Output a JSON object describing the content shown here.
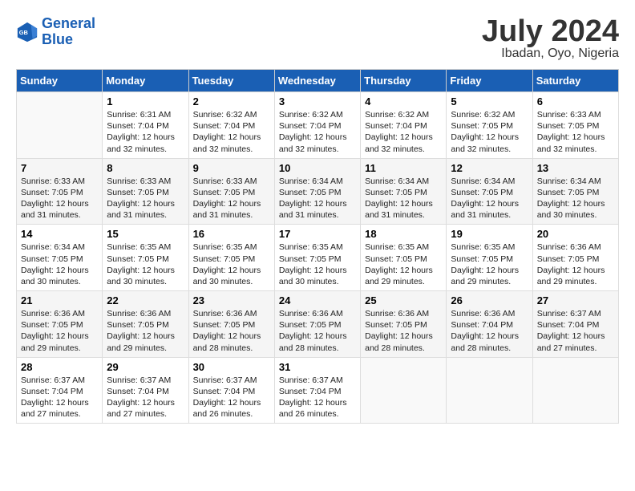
{
  "header": {
    "logo_line1": "General",
    "logo_line2": "Blue",
    "month": "July 2024",
    "location": "Ibadan, Oyo, Nigeria"
  },
  "weekdays": [
    "Sunday",
    "Monday",
    "Tuesday",
    "Wednesday",
    "Thursday",
    "Friday",
    "Saturday"
  ],
  "weeks": [
    [
      {
        "day": "",
        "content": ""
      },
      {
        "day": "1",
        "content": "Sunrise: 6:31 AM\nSunset: 7:04 PM\nDaylight: 12 hours\nand 32 minutes."
      },
      {
        "day": "2",
        "content": "Sunrise: 6:32 AM\nSunset: 7:04 PM\nDaylight: 12 hours\nand 32 minutes."
      },
      {
        "day": "3",
        "content": "Sunrise: 6:32 AM\nSunset: 7:04 PM\nDaylight: 12 hours\nand 32 minutes."
      },
      {
        "day": "4",
        "content": "Sunrise: 6:32 AM\nSunset: 7:04 PM\nDaylight: 12 hours\nand 32 minutes."
      },
      {
        "day": "5",
        "content": "Sunrise: 6:32 AM\nSunset: 7:05 PM\nDaylight: 12 hours\nand 32 minutes."
      },
      {
        "day": "6",
        "content": "Sunrise: 6:33 AM\nSunset: 7:05 PM\nDaylight: 12 hours\nand 32 minutes."
      }
    ],
    [
      {
        "day": "7",
        "content": "Sunrise: 6:33 AM\nSunset: 7:05 PM\nDaylight: 12 hours\nand 31 minutes."
      },
      {
        "day": "8",
        "content": "Sunrise: 6:33 AM\nSunset: 7:05 PM\nDaylight: 12 hours\nand 31 minutes."
      },
      {
        "day": "9",
        "content": "Sunrise: 6:33 AM\nSunset: 7:05 PM\nDaylight: 12 hours\nand 31 minutes."
      },
      {
        "day": "10",
        "content": "Sunrise: 6:34 AM\nSunset: 7:05 PM\nDaylight: 12 hours\nand 31 minutes."
      },
      {
        "day": "11",
        "content": "Sunrise: 6:34 AM\nSunset: 7:05 PM\nDaylight: 12 hours\nand 31 minutes."
      },
      {
        "day": "12",
        "content": "Sunrise: 6:34 AM\nSunset: 7:05 PM\nDaylight: 12 hours\nand 31 minutes."
      },
      {
        "day": "13",
        "content": "Sunrise: 6:34 AM\nSunset: 7:05 PM\nDaylight: 12 hours\nand 30 minutes."
      }
    ],
    [
      {
        "day": "14",
        "content": "Sunrise: 6:34 AM\nSunset: 7:05 PM\nDaylight: 12 hours\nand 30 minutes."
      },
      {
        "day": "15",
        "content": "Sunrise: 6:35 AM\nSunset: 7:05 PM\nDaylight: 12 hours\nand 30 minutes."
      },
      {
        "day": "16",
        "content": "Sunrise: 6:35 AM\nSunset: 7:05 PM\nDaylight: 12 hours\nand 30 minutes."
      },
      {
        "day": "17",
        "content": "Sunrise: 6:35 AM\nSunset: 7:05 PM\nDaylight: 12 hours\nand 30 minutes."
      },
      {
        "day": "18",
        "content": "Sunrise: 6:35 AM\nSunset: 7:05 PM\nDaylight: 12 hours\nand 29 minutes."
      },
      {
        "day": "19",
        "content": "Sunrise: 6:35 AM\nSunset: 7:05 PM\nDaylight: 12 hours\nand 29 minutes."
      },
      {
        "day": "20",
        "content": "Sunrise: 6:36 AM\nSunset: 7:05 PM\nDaylight: 12 hours\nand 29 minutes."
      }
    ],
    [
      {
        "day": "21",
        "content": "Sunrise: 6:36 AM\nSunset: 7:05 PM\nDaylight: 12 hours\nand 29 minutes."
      },
      {
        "day": "22",
        "content": "Sunrise: 6:36 AM\nSunset: 7:05 PM\nDaylight: 12 hours\nand 29 minutes."
      },
      {
        "day": "23",
        "content": "Sunrise: 6:36 AM\nSunset: 7:05 PM\nDaylight: 12 hours\nand 28 minutes."
      },
      {
        "day": "24",
        "content": "Sunrise: 6:36 AM\nSunset: 7:05 PM\nDaylight: 12 hours\nand 28 minutes."
      },
      {
        "day": "25",
        "content": "Sunrise: 6:36 AM\nSunset: 7:05 PM\nDaylight: 12 hours\nand 28 minutes."
      },
      {
        "day": "26",
        "content": "Sunrise: 6:36 AM\nSunset: 7:04 PM\nDaylight: 12 hours\nand 28 minutes."
      },
      {
        "day": "27",
        "content": "Sunrise: 6:37 AM\nSunset: 7:04 PM\nDaylight: 12 hours\nand 27 minutes."
      }
    ],
    [
      {
        "day": "28",
        "content": "Sunrise: 6:37 AM\nSunset: 7:04 PM\nDaylight: 12 hours\nand 27 minutes."
      },
      {
        "day": "29",
        "content": "Sunrise: 6:37 AM\nSunset: 7:04 PM\nDaylight: 12 hours\nand 27 minutes."
      },
      {
        "day": "30",
        "content": "Sunrise: 6:37 AM\nSunset: 7:04 PM\nDaylight: 12 hours\nand 26 minutes."
      },
      {
        "day": "31",
        "content": "Sunrise: 6:37 AM\nSunset: 7:04 PM\nDaylight: 12 hours\nand 26 minutes."
      },
      {
        "day": "",
        "content": ""
      },
      {
        "day": "",
        "content": ""
      },
      {
        "day": "",
        "content": ""
      }
    ]
  ]
}
